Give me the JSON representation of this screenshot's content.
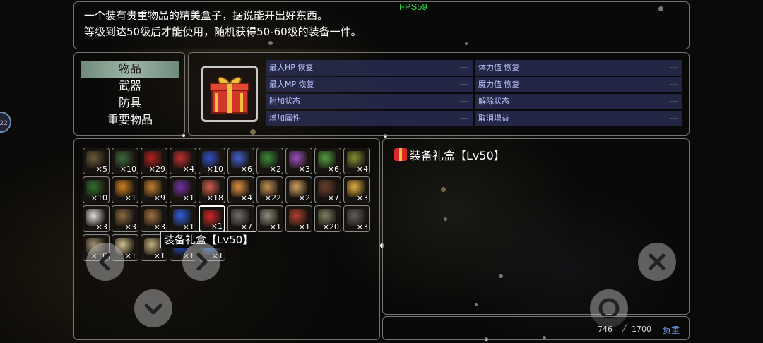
{
  "hud": {
    "fps": "FPS59"
  },
  "description": {
    "line1": "一个装有贵重物品的精美盒子，据说能开出好东西。",
    "line2": "等级到达50级后才能使用，随机获得50-60级的装备一件。"
  },
  "categories": [
    {
      "label": "物品",
      "selected": true
    },
    {
      "label": "武器",
      "selected": false
    },
    {
      "label": "防具",
      "selected": false
    },
    {
      "label": "重要物品",
      "selected": false
    }
  ],
  "stats": [
    {
      "label": "最大HP 恢复",
      "value": "---"
    },
    {
      "label": "体力值 恢复",
      "value": "---"
    },
    {
      "label": "最大MP 恢复",
      "value": "---"
    },
    {
      "label": "魔力值 恢复",
      "value": "---"
    },
    {
      "label": "附加状态",
      "value": "---"
    },
    {
      "label": "解除状态",
      "value": "---"
    },
    {
      "label": "增加属性",
      "value": "---"
    },
    {
      "label": "取消增益",
      "value": "---"
    }
  ],
  "inventory": [
    {
      "icon": "chest-icon",
      "count": "×5",
      "color": "#6a5a3a"
    },
    {
      "icon": "red-potion-icon",
      "count": "×10",
      "color": "#3a6a3a"
    },
    {
      "icon": "red-potion-icon",
      "count": "×29",
      "color": "#b02020"
    },
    {
      "icon": "red-potion-icon",
      "count": "×4",
      "color": "#c03030"
    },
    {
      "icon": "blue-potion-icon",
      "count": "×10",
      "color": "#3050c0"
    },
    {
      "icon": "blue-potion-icon",
      "count": "×6",
      "color": "#4060d0"
    },
    {
      "icon": "herb-icon",
      "count": "×2",
      "color": "#3a8a3a"
    },
    {
      "icon": "mushroom-icon",
      "count": "×3",
      "color": "#9a50c0"
    },
    {
      "icon": "leaf-icon",
      "count": "×6",
      "color": "#50a040"
    },
    {
      "icon": "seed-icon",
      "count": "×4",
      "color": "#809030"
    },
    {
      "icon": "plant-icon",
      "count": "×10",
      "color": "#307030"
    },
    {
      "icon": "pumpkin-icon",
      "count": "×1",
      "color": "#d08020"
    },
    {
      "icon": "gourd-icon",
      "count": "×9",
      "color": "#c08030"
    },
    {
      "icon": "eggplant-icon",
      "count": "×1",
      "color": "#7030a0"
    },
    {
      "icon": "meat-icon",
      "count": "×18",
      "color": "#d06050"
    },
    {
      "icon": "chicken-icon",
      "count": "×4",
      "color": "#e09040"
    },
    {
      "icon": "bread-icon",
      "count": "×22",
      "color": "#c09050"
    },
    {
      "icon": "pie-icon",
      "count": "×2",
      "color": "#d0a060"
    },
    {
      "icon": "chocolate-icon",
      "count": "×7",
      "color": "#6a4030"
    },
    {
      "icon": "cheese-icon",
      "count": "×3",
      "color": "#e0b040"
    },
    {
      "icon": "cotton-icon",
      "count": "×3",
      "color": "#e0e0e0"
    },
    {
      "icon": "stick-icon",
      "count": "×3",
      "color": "#8a6a40"
    },
    {
      "icon": "torch-icon",
      "count": "×3",
      "color": "#a07040"
    },
    {
      "icon": "blue-orb-icon",
      "count": "×1",
      "color": "#3060e0"
    },
    {
      "icon": "gift-box-icon",
      "count": "×1",
      "color": "#d02828",
      "selected": true
    },
    {
      "icon": "fish-icon",
      "count": "×7",
      "color": "#707070"
    },
    {
      "icon": "fish-icon",
      "count": "×1",
      "color": "#909080"
    },
    {
      "icon": "feather-icon",
      "count": "×1",
      "color": "#b04030"
    },
    {
      "icon": "ore-icon",
      "count": "×20",
      "color": "#808060"
    },
    {
      "icon": "scythe-icon",
      "count": "×3",
      "color": "#606060"
    },
    {
      "icon": "bone-icon",
      "count": "×10",
      "color": "#a09070"
    },
    {
      "icon": "scroll-icon",
      "count": "×1",
      "color": "#d0c090"
    },
    {
      "icon": "scroll-icon",
      "count": "×1",
      "color": "#c0b080"
    },
    {
      "icon": "gem-icon",
      "count": "×1",
      "color": "#2050d0"
    },
    {
      "icon": "gem-icon",
      "count": "×1",
      "color": "#3070e0"
    }
  ],
  "tooltip": {
    "label": "装备礼盒【Lv50】"
  },
  "detail": {
    "title": "装备礼盒【Lv50】"
  },
  "weight": {
    "current": "746",
    "max": "1700",
    "label": "负重"
  },
  "side_badge": {
    "text": "22"
  },
  "colors": {
    "fps": "#2fd54a",
    "stat_bg": "#282d50",
    "category_selected": "#9fb6a8",
    "weight_label": "#7aa0ff"
  }
}
